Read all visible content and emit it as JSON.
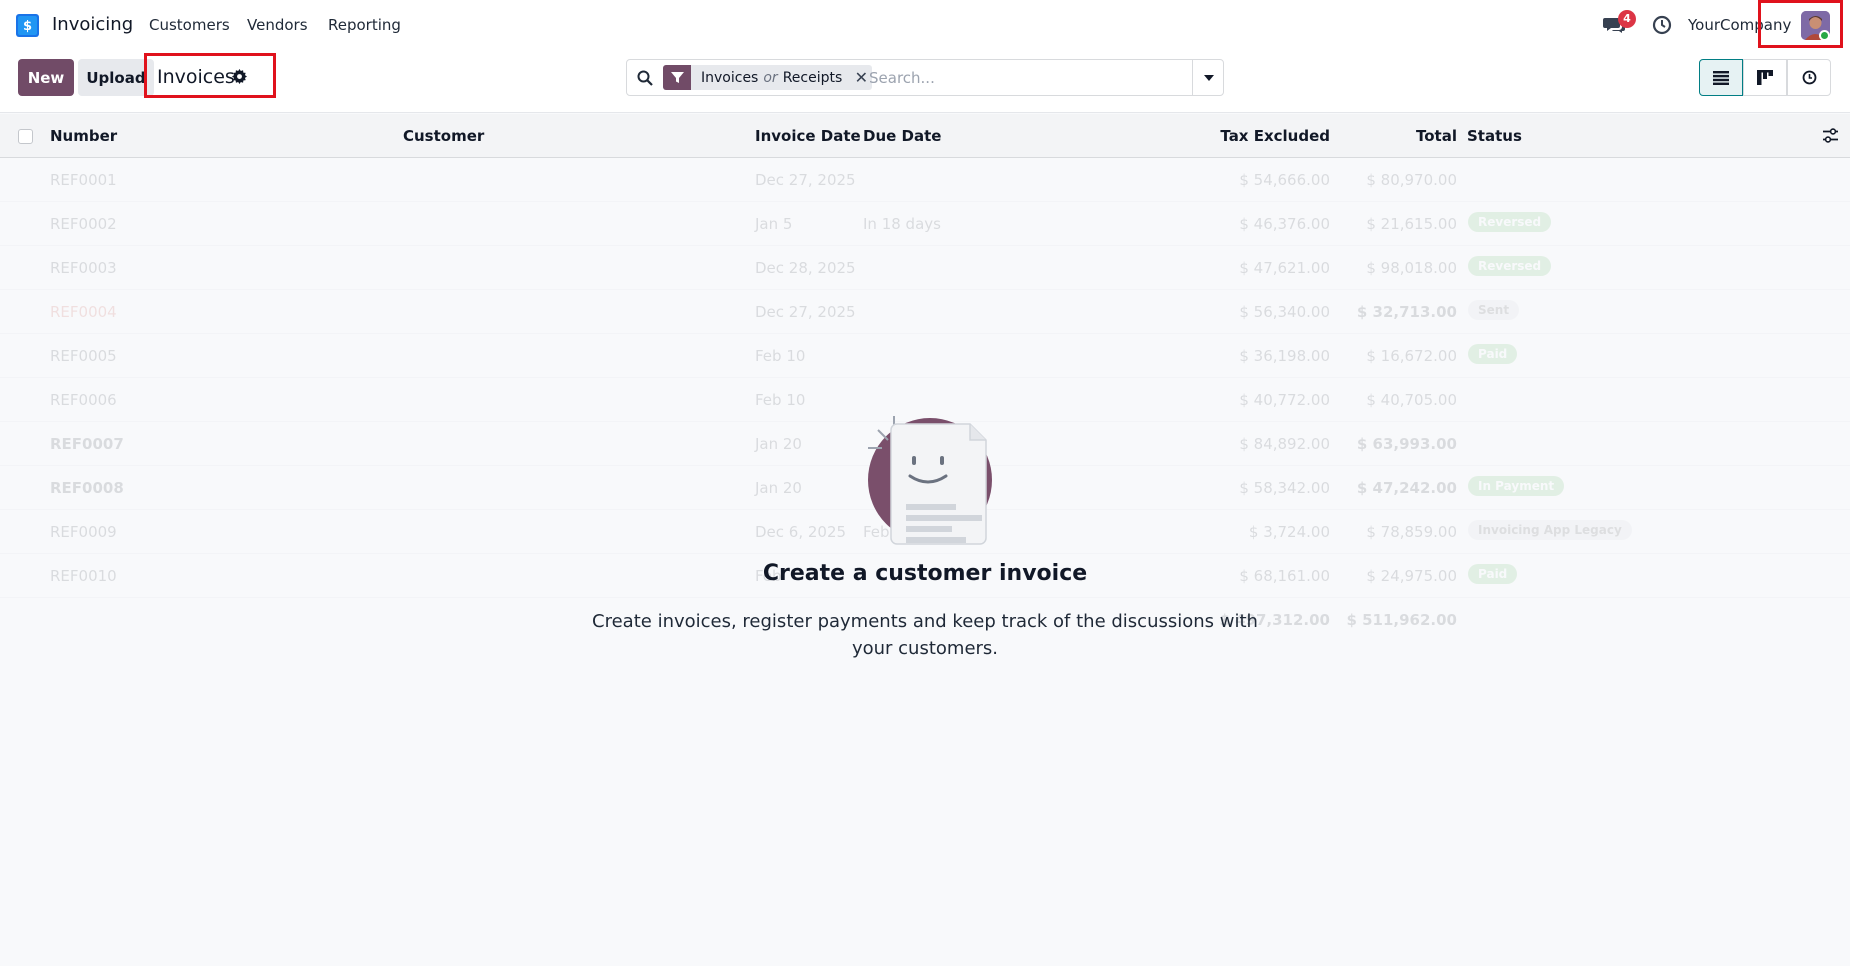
{
  "topnav": {
    "app_title": "Invoicing",
    "menu": [
      "Customers",
      "Vendors",
      "Reporting"
    ],
    "messages_count": "4",
    "company": "YourCompany"
  },
  "control": {
    "new_label": "New",
    "upload_label": "Upload",
    "breadcrumb": "Invoices",
    "facet": {
      "values": [
        "Invoices",
        "Receipts"
      ],
      "separator": "or"
    },
    "search_placeholder": "Search..."
  },
  "table": {
    "columns": {
      "number": "Number",
      "customer": "Customer",
      "invoice_date": "Invoice Date",
      "due_date": "Due Date",
      "tax_excluded": "Tax Excluded",
      "total": "Total",
      "status": "Status"
    },
    "rows": [
      {
        "number": "REF0001",
        "invoice_date": "Dec 27, 2025",
        "due_date": "",
        "tax": "$ 54,666.00",
        "total": "$ 80,970.00",
        "status": "",
        "status_style": ""
      },
      {
        "number": "REF0002",
        "invoice_date": "Jan 5",
        "due_date": "In 18 days",
        "tax": "$ 46,376.00",
        "total": "$ 21,615.00",
        "status": "Reversed",
        "status_style": "green"
      },
      {
        "number": "REF0003",
        "invoice_date": "Dec 28, 2025",
        "due_date": "",
        "tax": "$ 47,621.00",
        "total": "$ 98,018.00",
        "status": "Reversed",
        "status_style": "green"
      },
      {
        "number": "REF0004",
        "invoice_date": "Dec 27, 2025",
        "due_date": "",
        "tax": "$ 56,340.00",
        "total": "$ 32,713.00",
        "status": "Sent",
        "status_style": "grey"
      },
      {
        "number": "REF0005",
        "invoice_date": "Feb 10",
        "due_date": "",
        "tax": "$ 36,198.00",
        "total": "$ 16,672.00",
        "status": "Paid",
        "status_style": "green"
      },
      {
        "number": "REF0006",
        "invoice_date": "Feb 10",
        "due_date": "",
        "tax": "$ 40,772.00",
        "total": "$ 40,705.00",
        "status": "",
        "status_style": ""
      },
      {
        "number": "REF0007",
        "invoice_date": "Jan 20",
        "due_date": "",
        "tax": "$ 84,892.00",
        "total": "$ 63,993.00",
        "status": "",
        "status_style": ""
      },
      {
        "number": "REF0008",
        "invoice_date": "Jan 20",
        "due_date": "",
        "tax": "$ 58,342.00",
        "total": "$ 47,242.00",
        "status": "In Payment",
        "status_style": "green"
      },
      {
        "number": "REF0009",
        "invoice_date": "Dec 6, 2025",
        "due_date": "Feb",
        "tax": "$ 3,724.00",
        "total": "$ 78,859.00",
        "status": "Invoicing App Legacy",
        "status_style": "grey"
      },
      {
        "number": "REF0010",
        "invoice_date": "Feb",
        "due_date": "",
        "tax": "$ 68,161.00",
        "total": "$ 24,975.00",
        "status": "Paid",
        "status_style": "green"
      }
    ],
    "totals": {
      "tax": "$ 497,312.00",
      "total": "$ 511,962.00"
    }
  },
  "empty_state": {
    "title": "Create a customer invoice",
    "text": "Create invoices, register payments and keep track of the discussions with your customers."
  },
  "colors": {
    "brand": "#714b67",
    "accent": "#017e84",
    "highlight": "#e0121c"
  }
}
